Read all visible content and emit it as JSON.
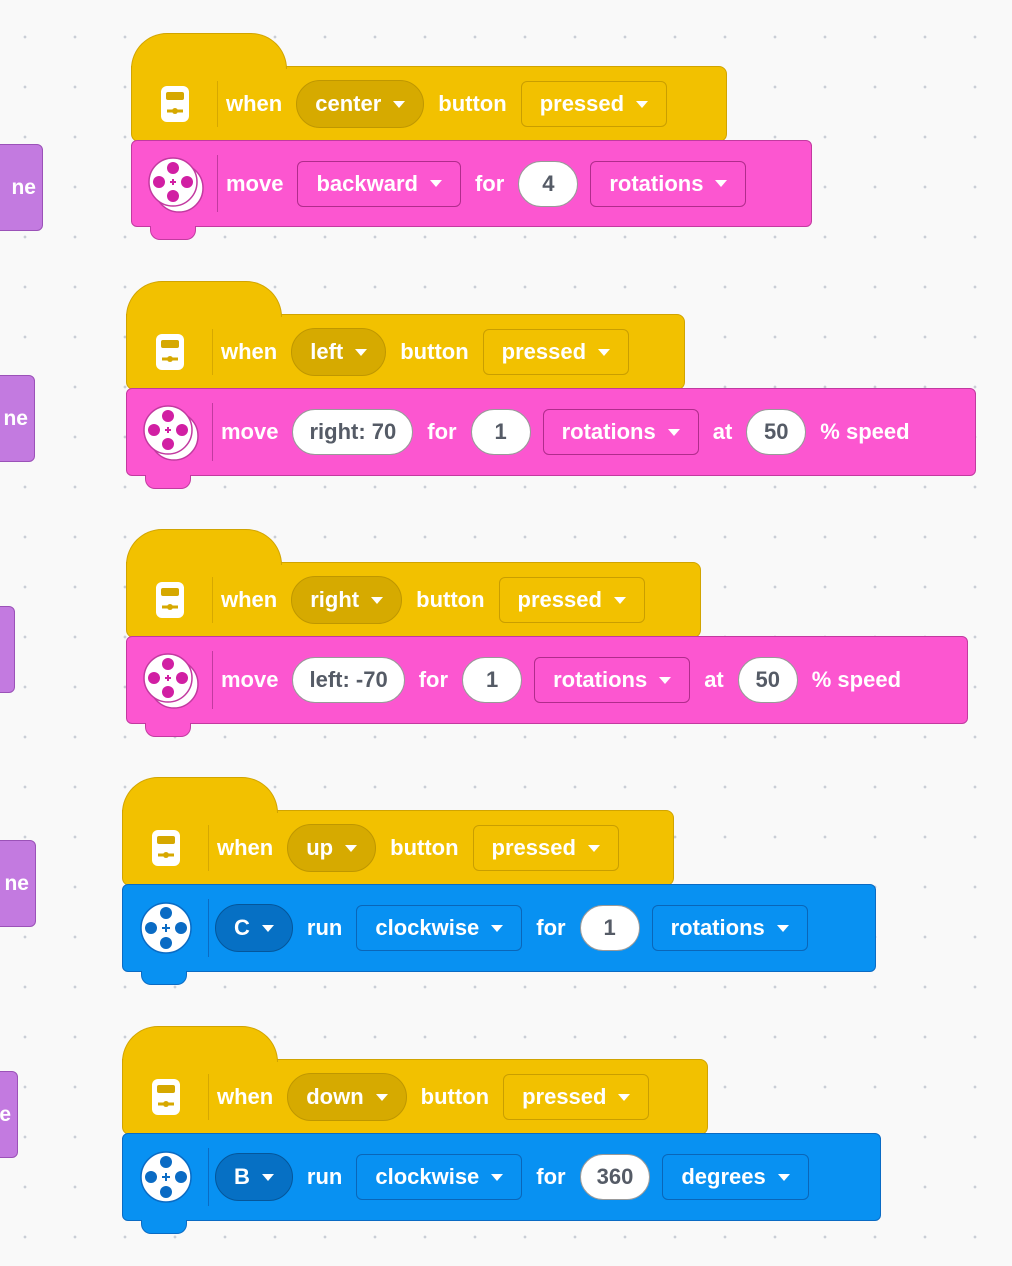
{
  "side_blocks": [
    "ne",
    "ne",
    "",
    "ne",
    "e"
  ],
  "scripts": [
    {
      "trigger": {
        "when": "when",
        "button_choice": "center",
        "button": "button",
        "state": "pressed"
      },
      "action": {
        "type": "move",
        "word": "move",
        "direction": "backward",
        "for": "for",
        "amount": "4",
        "unit": "rotations"
      }
    },
    {
      "trigger": {
        "when": "when",
        "button_choice": "left",
        "button": "button",
        "state": "pressed"
      },
      "action": {
        "type": "move-steer",
        "word": "move",
        "steer": "right: 70",
        "for": "for",
        "amount": "1",
        "unit": "rotations",
        "at": "at",
        "speed": "50",
        "speed_unit": "% speed"
      }
    },
    {
      "trigger": {
        "when": "when",
        "button_choice": "right",
        "button": "button",
        "state": "pressed"
      },
      "action": {
        "type": "move-steer",
        "word": "move",
        "steer": "left: -70",
        "for": "for",
        "amount": "1",
        "unit": "rotations",
        "at": "at",
        "speed": "50",
        "speed_unit": "% speed"
      }
    },
    {
      "trigger": {
        "when": "when",
        "button_choice": "up",
        "button": "button",
        "state": "pressed"
      },
      "action": {
        "type": "motor",
        "port": "C",
        "run": "run",
        "direction": "clockwise",
        "for": "for",
        "amount": "1",
        "unit": "rotations"
      }
    },
    {
      "trigger": {
        "when": "when",
        "button_choice": "down",
        "button": "button",
        "state": "pressed"
      },
      "action": {
        "type": "motor",
        "port": "B",
        "run": "run",
        "direction": "clockwise",
        "for": "for",
        "amount": "360",
        "unit": "degrees"
      }
    }
  ],
  "icons": {
    "hub": "hub-button-icon",
    "movement": "movement-motors-icon",
    "motor": "motor-icon"
  },
  "colors": {
    "events": "#f2c100",
    "movement": "#fc56d0",
    "motors": "#0891f2",
    "more": "#c37ae0"
  }
}
